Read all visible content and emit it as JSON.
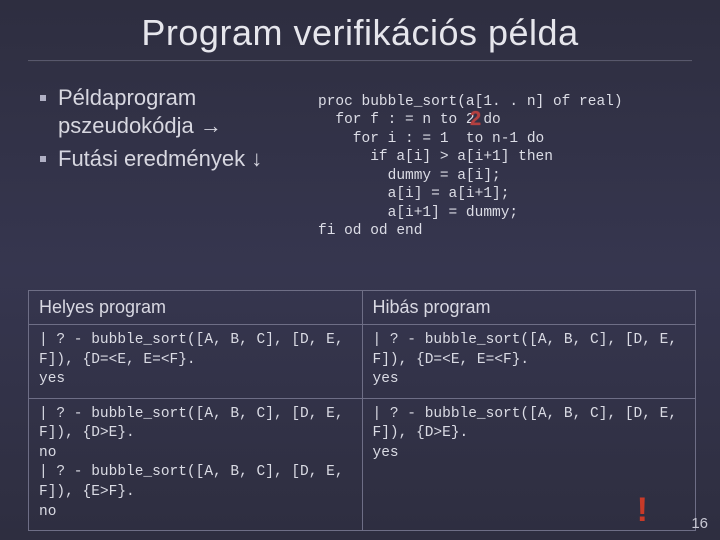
{
  "title": "Program verifikációs példa",
  "bullets": [
    "Példaprogram pszeudokódja →",
    "Futási eredmények ↓"
  ],
  "code": {
    "l1": "proc bubble_sort(a[1. . n] of real)",
    "l2": "  for f : = n to 2 do",
    "l3": "    for i : = 1  to n-1 do",
    "l4": "      if a[i] > a[i+1] then",
    "l5": "        dummy = a[i];",
    "l6": "        a[i] = a[i+1];",
    "l7": "        a[i+1] = dummy;",
    "l8": "fi od od end"
  },
  "overlay2": "2",
  "table": {
    "h1": "Helyes program",
    "h2": "Hibás program",
    "r1c1": "| ? - bubble_sort([A, B, C], [D, E, F]), {D=<E, E=<F}.\nyes",
    "r1c2": "| ? - bubble_sort([A, B, C], [D, E, F]), {D=<E, E=<F}.\nyes",
    "r2c1": "| ? - bubble_sort([A, B, C], [D, E, F]), {D>E}.\nno\n| ? - bubble_sort([A, B, C], [D, E, F]), {E>F}.\nno",
    "r2c2": "| ? - bubble_sort([A, B, C], [D, E, F]), {D>E}.\nyes"
  },
  "excl": "!",
  "pageno": "16"
}
